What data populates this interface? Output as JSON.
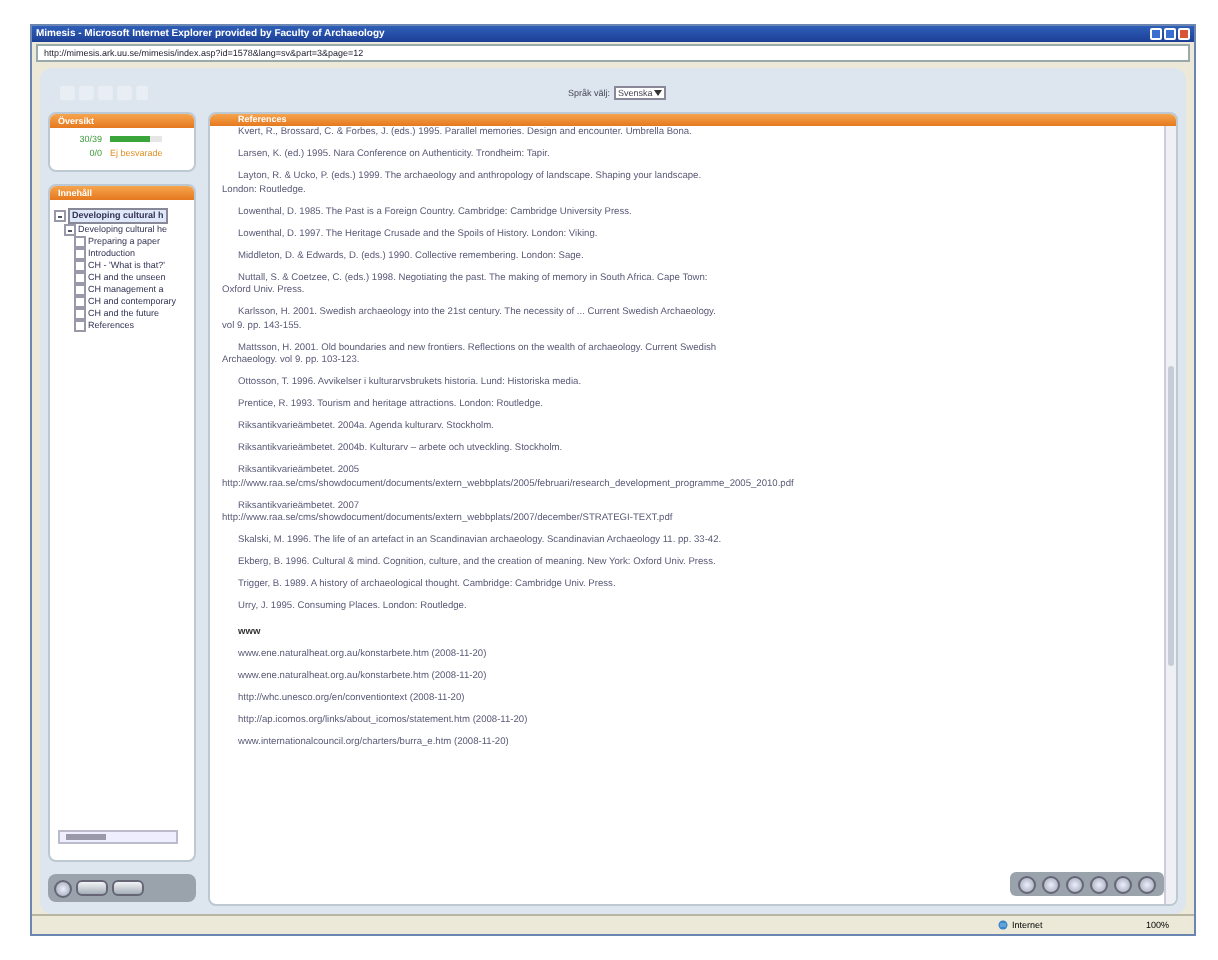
{
  "window": {
    "title": "Mimesis - Microsoft Internet Explorer provided by Faculty of Archaeology",
    "address": "http://mimesis.ark.uu.se/mimesis/index.asp?id=1578&lang=sv&part=3&page=12"
  },
  "language": {
    "label": "Språk välj:",
    "value": "Svenska"
  },
  "progress_panel": {
    "title": "Översikt",
    "rows": [
      {
        "kind": "bar",
        "label": "30/39",
        "level": 0.77
      },
      {
        "kind": "text",
        "label": "0/0",
        "note": "Ej besvarade"
      }
    ]
  },
  "toc": {
    "title": "Innehåll",
    "items": [
      {
        "label": "Developing cultural h",
        "selected": true,
        "expanded": true,
        "children": [
          {
            "label": "Developing cultural he",
            "selected": false,
            "expanded": true,
            "children": [
              {
                "label": "Preparing a paper",
                "selected": false
              },
              {
                "label": "Introduction",
                "selected": false
              },
              {
                "label": "CH - 'What is that?'",
                "selected": false
              },
              {
                "label": "CH and the unseen",
                "selected": false
              },
              {
                "label": "CH management a",
                "selected": false
              },
              {
                "label": "CH and contemporary",
                "selected": false
              },
              {
                "label": "CH and the future",
                "selected": false
              },
              {
                "label": "References",
                "selected": false
              }
            ]
          }
        ]
      }
    ]
  },
  "content": {
    "title": "References",
    "entries": [
      {
        "kind": "entry",
        "text": "Kvert, R., Brossard, C. & Forbes, J. (eds.) 1995. Parallel memories. Design and encounter. Umbrella Bona."
      },
      {
        "kind": "entry",
        "text": "Larsen, K. (ed.) 1995. Nara Conference on Authenticity. Trondheim: Tapir."
      },
      {
        "kind": "entry",
        "text": "Layton, R. & Ucko, P. (eds.) 1999. The archaeology and anthropology of landscape. Shaping your landscape. London: Routledge."
      },
      {
        "kind": "entry",
        "text": "Lowenthal, D. 1985. The Past is a Foreign Country. Cambridge: Cambridge University Press."
      },
      {
        "kind": "entry",
        "text": "Lowenthal, D. 1997. The Heritage Crusade and the Spoils of History. London: Viking."
      },
      {
        "kind": "entry",
        "text": "Middleton, D. & Edwards, D. (eds.) 1990. Collective remembering. London: Sage."
      },
      {
        "kind": "entry",
        "text": "Nuttall, S. & Coetzee, C. (eds.) 1998. Negotiating the past. The making of memory in South Africa. Cape Town: Oxford Univ. Press."
      },
      {
        "kind": "entry",
        "text": "Karlsson, H. 2001. Swedish archaeology into the 21st century. The necessity of ... Current Swedish Archaeology. vol 9. pp. 143-155."
      },
      {
        "kind": "entry",
        "text": "Mattsson, H. 2001. Old boundaries and new frontiers. Reflections on the wealth of archaeology. Current Swedish Archaeology. vol 9. pp. 103-123."
      },
      {
        "kind": "entry",
        "text": "Ottosson, T. 1996. Avvikelser i kulturarvsbrukets historia. Lund: Historiska media."
      },
      {
        "kind": "entry",
        "text": "Prentice, R. 1993. Tourism and heritage attractions. London: Routledge."
      },
      {
        "kind": "entry",
        "text": "Riksantikvarieämbetet. 2004a. Agenda kulturarv. Stockholm."
      },
      {
        "kind": "entry",
        "text": "Riksantikvarieämbetet. 2004b. Kulturarv – arbete och utveckling. Stockholm."
      },
      {
        "kind": "entry",
        "text": "Riksantikvarieämbetet. 2005",
        "url": "http://www.raa.se/cms/showdocument/documents/extern_webbplats/2005/februari/research_development_programme_2005_2010.pdf"
      },
      {
        "kind": "entry",
        "text": "Riksantikvarieämbetet. 2007",
        "url": "http://www.raa.se/cms/showdocument/documents/extern_webbplats/2007/december/STRATEGI-TEXT.pdf"
      },
      {
        "kind": "entry",
        "text": "Skalski, M. 1996. The life of an artefact in an Scandinavian archaeology. Scandinavian Archaeology 11. pp. 33-42."
      },
      {
        "kind": "entry",
        "text": "Ekberg, B. 1996. Cultural & mind. Cognition, culture, and the creation of meaning. New York: Oxford Univ. Press."
      },
      {
        "kind": "entry",
        "text": "Trigger, B. 1989. A history of archaeological thought. Cambridge: Cambridge Univ. Press."
      },
      {
        "kind": "entry",
        "text": "Urry, J. 1995. Consuming Places. London: Routledge."
      },
      {
        "kind": "heading",
        "text": "www"
      },
      {
        "kind": "link",
        "text": "www.ene.naturalheat.org.au/konstarbete.htm (2008-11-20)"
      },
      {
        "kind": "link",
        "text": "www.ene.naturalheat.org.au/konstarbete.htm (2008-11-20)"
      },
      {
        "kind": "link",
        "text": "http://whc.unesco.org/en/conventiontext (2008-11-20)"
      },
      {
        "kind": "link",
        "text": "http://ap.icomos.org/links/about_icomos/statement.htm (2008-11-20)"
      },
      {
        "kind": "link",
        "text": "www.internationalcouncil.org/charters/burra_e.htm (2008-11-20)"
      }
    ]
  },
  "status_bar": {
    "zone": "Internet",
    "zoom": "100%"
  }
}
